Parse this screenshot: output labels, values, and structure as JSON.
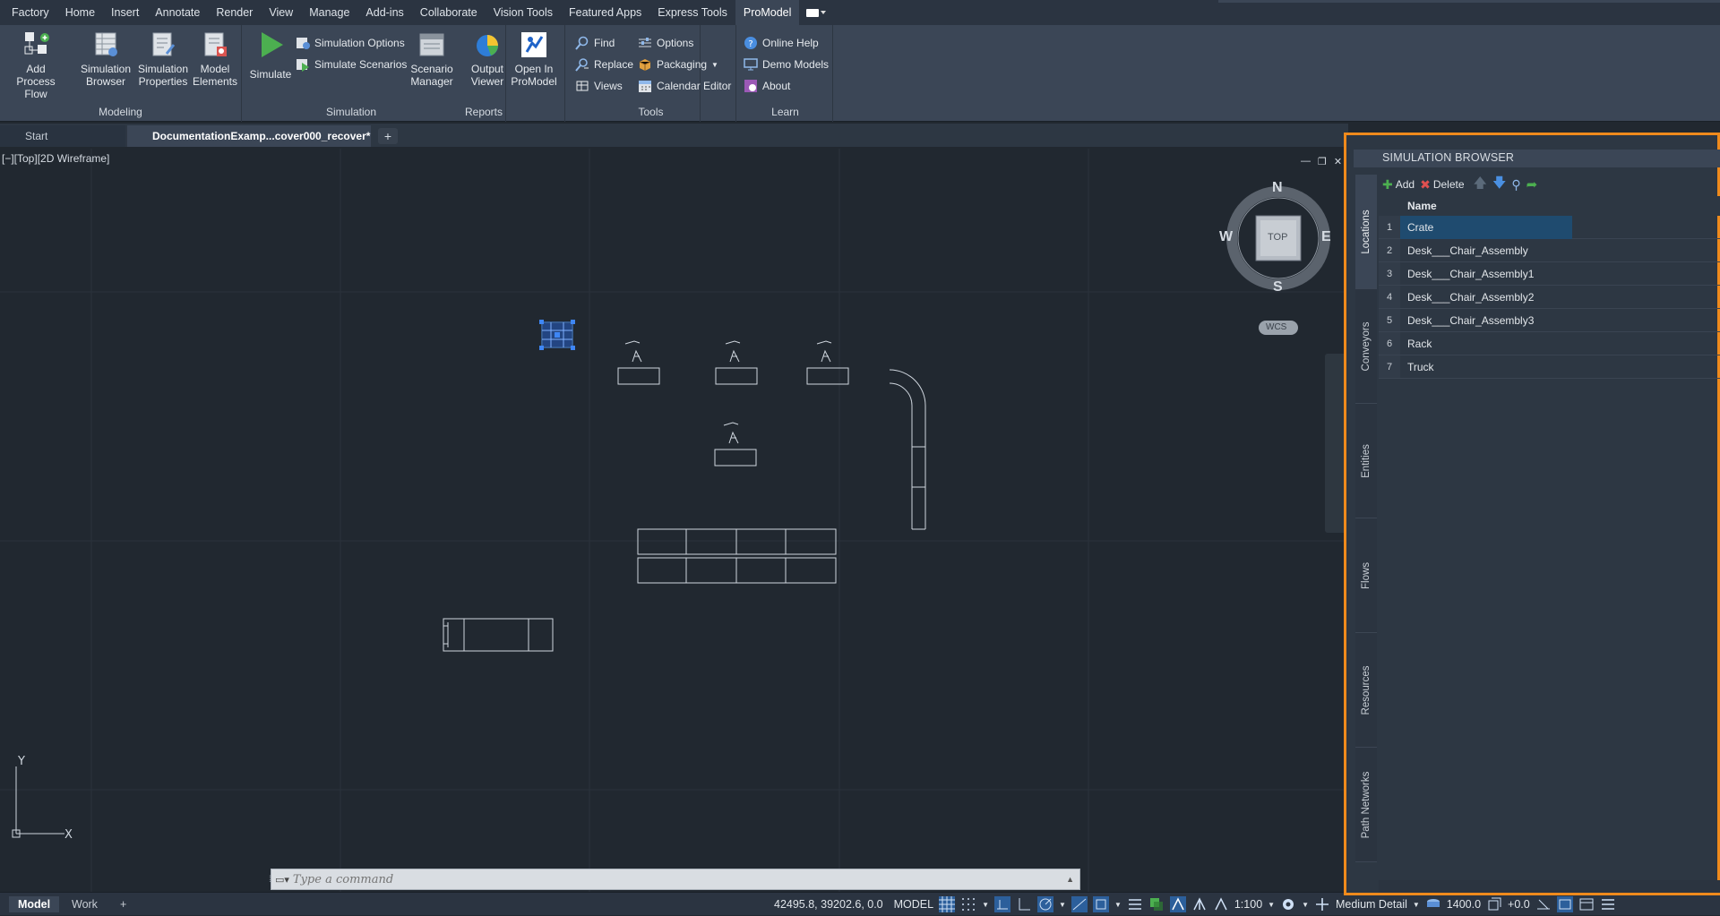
{
  "ribbon_tabs": [
    "Factory",
    "Home",
    "Insert",
    "Annotate",
    "Render",
    "View",
    "Manage",
    "Add-ins",
    "Collaborate",
    "Vision Tools",
    "Featured Apps",
    "Express Tools",
    "ProModel"
  ],
  "ribbon": {
    "modeling": {
      "label": "Modeling",
      "add_process_flow": [
        "Add",
        "Process Flow"
      ],
      "simulation_browser": [
        "Simulation",
        "Browser"
      ],
      "simulation_properties": [
        "Simulation",
        "Properties"
      ],
      "model_elements": [
        "Model",
        "Elements"
      ]
    },
    "simulation": {
      "label": "Simulation",
      "simulate": "Simulate",
      "simulation_options": "Simulation Options",
      "simulate_scenarios": "Simulate Scenarios",
      "scenario_manager": [
        "Scenario",
        "Manager"
      ]
    },
    "reports": {
      "label": "Reports",
      "output_viewer": [
        "Output",
        "Viewer"
      ]
    },
    "open_in_promodel": [
      "Open In",
      "ProModel"
    ],
    "tools": {
      "label": "Tools",
      "find": "Find",
      "replace": "Replace",
      "views": "Views",
      "options": "Options",
      "packaging": "Packaging",
      "calendar_editor": "Calendar Editor"
    },
    "learn": {
      "label": "Learn",
      "online_help": "Online Help",
      "demo_models": "Demo Models",
      "about": "About"
    }
  },
  "doc_tabs": {
    "start": "Start",
    "active": "DocumentationExamp...cover000_recover*",
    "close": "✕",
    "add": "+"
  },
  "viewport": {
    "label": "[−][Top][2D Wireframe]",
    "compass": {
      "n": "N",
      "s": "S",
      "e": "E",
      "w": "W",
      "top": "TOP",
      "wcs": "WCS"
    },
    "axis_y": "Y",
    "axis_x": "X"
  },
  "command": {
    "placeholder": "Type a command"
  },
  "status": {
    "model_tab": "Model",
    "work_tab": "Work",
    "add": "+",
    "coords": "42495.8, 39202.6, 0.0",
    "mode": "MODEL",
    "scale": "1:100",
    "detail": "Medium Detail",
    "value": "1400.0",
    "offset": "+0.0"
  },
  "sim_browser": {
    "title": "SIMULATION BROWSER",
    "tabs": [
      "Locations",
      "Conveyors",
      "Entities",
      "Flows",
      "Resources",
      "Path Networks"
    ],
    "toolbar": {
      "add": "Add",
      "delete": "Delete"
    },
    "column": "Name",
    "rows": [
      {
        "num": "1",
        "name": "Crate"
      },
      {
        "num": "2",
        "name": "Desk___Chair_Assembly"
      },
      {
        "num": "3",
        "name": "Desk___Chair_Assembly1"
      },
      {
        "num": "4",
        "name": "Desk___Chair_Assembly2"
      },
      {
        "num": "5",
        "name": "Desk___Chair_Assembly3"
      },
      {
        "num": "6",
        "name": "Rack"
      },
      {
        "num": "7",
        "name": "Truck"
      }
    ]
  },
  "colors": {
    "accent_orange": "#ef8a1c",
    "selection_blue": "#1f4b6f",
    "background": "#212830"
  }
}
